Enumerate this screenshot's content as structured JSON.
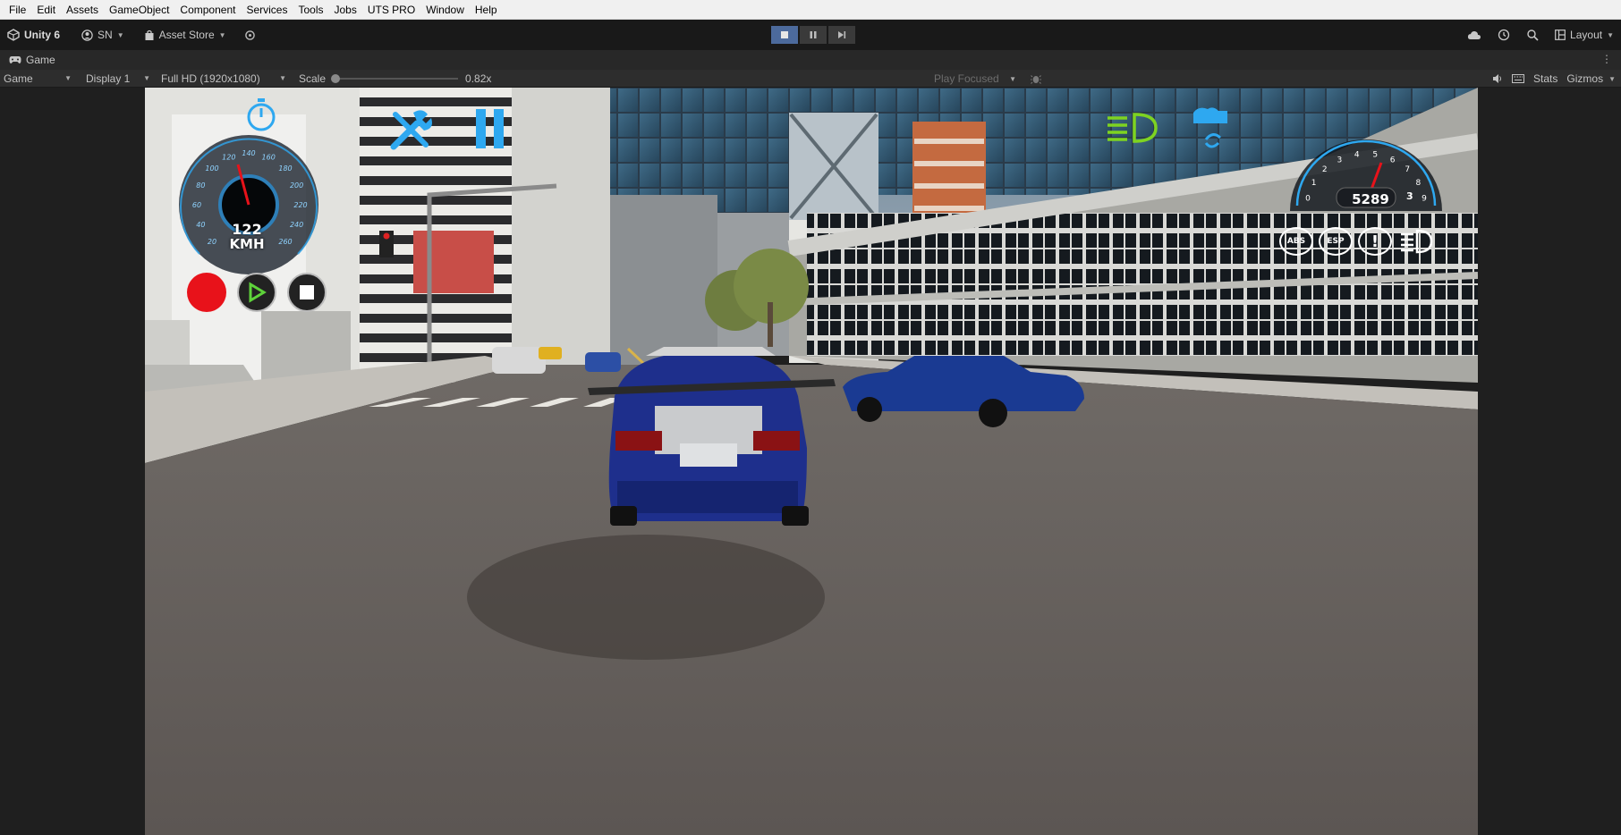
{
  "menubar": {
    "items": [
      "File",
      "Edit",
      "Assets",
      "GameObject",
      "Component",
      "Services",
      "Tools",
      "Jobs",
      "UTS PRO",
      "Window",
      "Help"
    ]
  },
  "toolbar": {
    "unity_label": "Unity 6",
    "account_label": "SN",
    "asset_store_label": "Asset Store",
    "layout_label": "Layout"
  },
  "tab": {
    "label": "Game"
  },
  "gamebar": {
    "mode": "Game",
    "display": "Display 1",
    "resolution": "Full HD (1920x1080)",
    "scale_label": "Scale",
    "scale_value": "0.82x",
    "scale_fraction": 0.0,
    "play_mode": "Play Focused",
    "stats": "Stats",
    "gizmos": "Gizmos"
  },
  "hud": {
    "speed": "122",
    "speed_unit": "KMH",
    "speed_ticks": [
      "20",
      "40",
      "60",
      "80",
      "100",
      "120",
      "140",
      "160",
      "180",
      "200",
      "220",
      "240",
      "260"
    ],
    "rpm": "5289",
    "rpm_ticks": [
      "0",
      "1",
      "2",
      "3",
      "4",
      "5",
      "6",
      "7",
      "8",
      "9"
    ],
    "gear": "3",
    "warnings": [
      "ABS",
      "ESP",
      "!"
    ],
    "colors": {
      "hud_blue": "#2ea8f0",
      "hud_green": "#7ed321",
      "record_red": "#e8121a",
      "play_green": "#5ed33a"
    }
  }
}
